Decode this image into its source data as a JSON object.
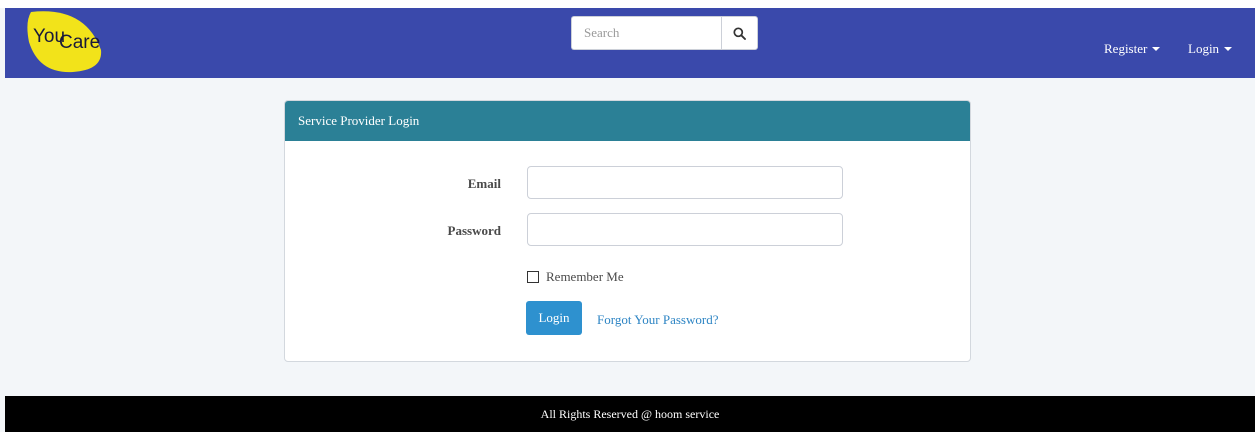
{
  "brand": {
    "logo_text_1": "You",
    "logo_text_2": "Care",
    "logo_color": "#f2e31a"
  },
  "header": {
    "search_placeholder": "Search",
    "register_label": "Register",
    "login_label": "Login",
    "bg_color": "#3a49ab"
  },
  "panel": {
    "title": "Service Provider Login",
    "heading_color": "#2b8096",
    "email_label": "Email",
    "email_value": "",
    "password_label": "Password",
    "password_value": "",
    "remember_label": "Remember Me",
    "login_button": "Login",
    "forgot_link": "Forgot Your Password?",
    "button_color": "#2e91cf"
  },
  "footer": {
    "text": "All Rights Reserved @ hoom service"
  }
}
